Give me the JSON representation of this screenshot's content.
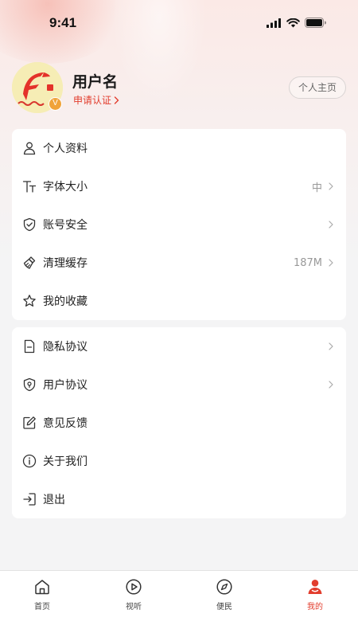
{
  "status_bar": {
    "time": "9:41"
  },
  "profile": {
    "username": "用户名",
    "apply_verify": "申请认证",
    "home_button": "个人主页",
    "badge": "V"
  },
  "menu_group_1": [
    {
      "label": "个人资料",
      "value": "",
      "icon": "user-icon"
    },
    {
      "label": "字体大小",
      "value": "中",
      "icon": "font-size-icon"
    },
    {
      "label": "账号安全",
      "value": "",
      "icon": "shield-check-icon"
    },
    {
      "label": "清理缓存",
      "value": "187M",
      "icon": "broom-icon"
    },
    {
      "label": "我的收藏",
      "value": "",
      "icon": "star-icon"
    }
  ],
  "menu_group_2": [
    {
      "label": "隐私协议",
      "value": "",
      "icon": "document-icon"
    },
    {
      "label": "用户协议",
      "value": "",
      "icon": "shield-location-icon"
    },
    {
      "label": "意见反馈",
      "value": "",
      "icon": "edit-icon"
    },
    {
      "label": "关于我们",
      "value": "",
      "icon": "info-icon"
    },
    {
      "label": "退出",
      "value": "",
      "icon": "logout-icon"
    }
  ],
  "tabbar": {
    "tabs": [
      {
        "label": "首页",
        "icon": "home-icon"
      },
      {
        "label": "视听",
        "icon": "play-icon"
      },
      {
        "label": "便民",
        "icon": "compass-icon"
      },
      {
        "label": "我的",
        "icon": "profile-icon",
        "active": true
      }
    ]
  },
  "colors": {
    "accent": "#e23d2d",
    "background": "#f4f4f5"
  }
}
